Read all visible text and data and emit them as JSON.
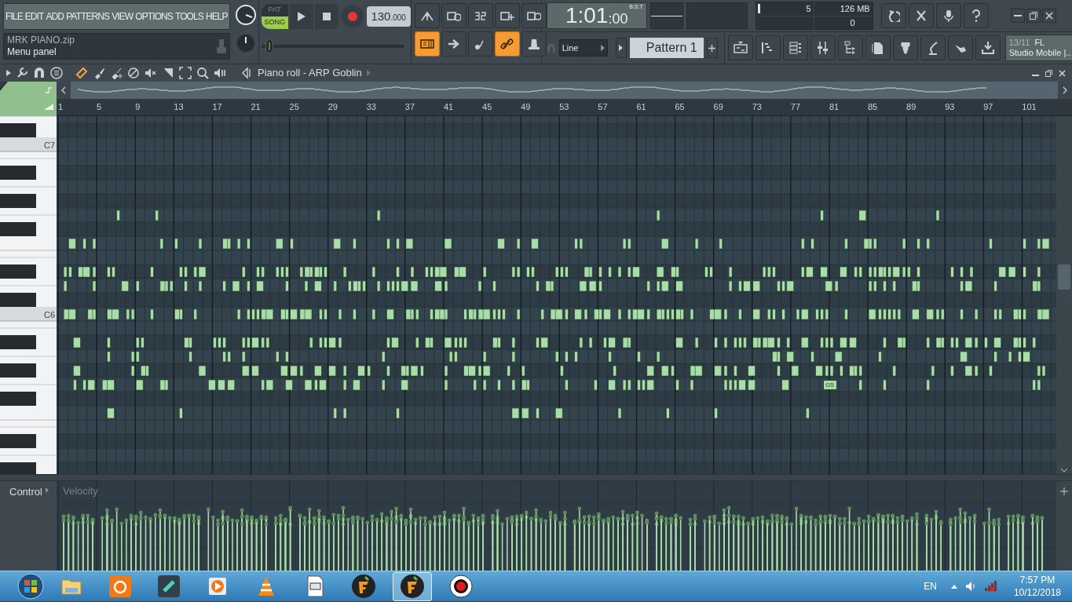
{
  "menu": [
    "FILE",
    "EDIT",
    "ADD",
    "PATTERNS",
    "VIEW",
    "OPTIONS",
    "TOOLS",
    "HELP"
  ],
  "project": {
    "file": "MRK PIANO.zip",
    "hint": "Menu panel"
  },
  "transport": {
    "modes": [
      {
        "label": "PAT",
        "selected": false
      },
      {
        "label": "SONG",
        "selected": true
      }
    ],
    "tempo": "130",
    "tempo_fraction": ".000",
    "pitch_slider": {
      "level": 0.03
    }
  },
  "time": {
    "value": "1:01",
    "ticks": ":00",
    "format": "B:S:T"
  },
  "monitor": {
    "voices": "5",
    "memory": "126 MB",
    "polyphony": "0"
  },
  "toggles": [
    {
      "kind": "typing-keyboard",
      "on": true
    },
    {
      "kind": "arrow",
      "on": false
    },
    {
      "kind": "step",
      "on": false
    },
    {
      "kind": "link",
      "on": true
    },
    {
      "kind": "metronome",
      "on": false
    }
  ],
  "snap": "Line",
  "pattern": "Pattern 1",
  "news": {
    "date": "13/11",
    "title": "FL",
    "text": "Studio Mobile |.."
  },
  "piano_roll": {
    "title": "Piano roll - ARP Goblin",
    "bars": [
      "1",
      "5",
      "9",
      "13",
      "17",
      "21",
      "25",
      "29",
      "33",
      "37",
      "41",
      "45",
      "49",
      "53",
      "57",
      "61",
      "65",
      "69",
      "73",
      "77",
      "81",
      "85",
      "89",
      "93",
      "97",
      "101"
    ],
    "key_labels": [
      "C7",
      "C6"
    ],
    "note_label": "G5"
  },
  "control": {
    "label": "Control",
    "parameter": "Velocity"
  },
  "taskbar": {
    "apps": [
      {
        "kind": "folder",
        "selected": false
      },
      {
        "kind": "browser",
        "selected": false
      },
      {
        "kind": "editor",
        "selected": false
      },
      {
        "kind": "media",
        "selected": false
      },
      {
        "kind": "cone",
        "selected": false
      },
      {
        "kind": "document",
        "selected": false
      },
      {
        "kind": "fruit",
        "selected": false
      },
      {
        "kind": "fruit",
        "selected": true
      },
      {
        "kind": "recorder",
        "selected": false
      }
    ],
    "language": "EN",
    "time": "7:57 PM",
    "date": "10/12/2018"
  }
}
